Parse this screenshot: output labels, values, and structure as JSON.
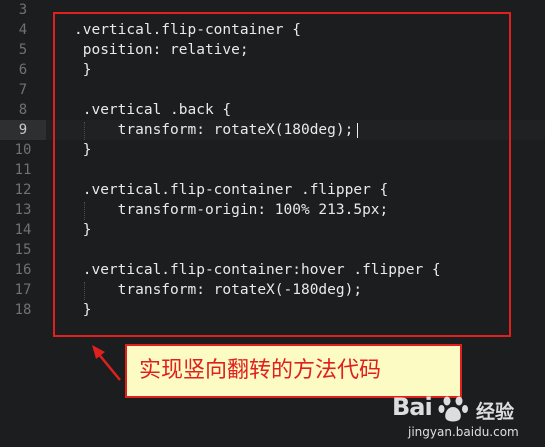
{
  "editor": {
    "line_numbers": [
      "3",
      "4",
      "5",
      "6",
      "7",
      "8",
      "9",
      "10",
      "11",
      "12",
      "13",
      "14",
      "15",
      "16",
      "17",
      "18"
    ],
    "active_line": "9",
    "lines": [
      ".vertical.flip-container {",
      " position: relative;",
      " }",
      "",
      " .vertical .back {",
      "     transform: rotateX(180deg);",
      " }",
      "",
      " .vertical.flip-container .flipper {",
      "     transform-origin: 100% 213.5px;",
      " }",
      "",
      " .vertical.flip-container:hover .flipper {",
      "     transform: rotateX(-180deg);",
      " }",
      ""
    ]
  },
  "annotation": {
    "callout_text": "实现竖向翻转的方法代码",
    "border_color": "#e0201e",
    "callout_bg": "#fdfbc4"
  },
  "watermark": {
    "logo_text": "Bai",
    "logo_suffix": "经验",
    "url": "jingyan.baidu.com"
  }
}
